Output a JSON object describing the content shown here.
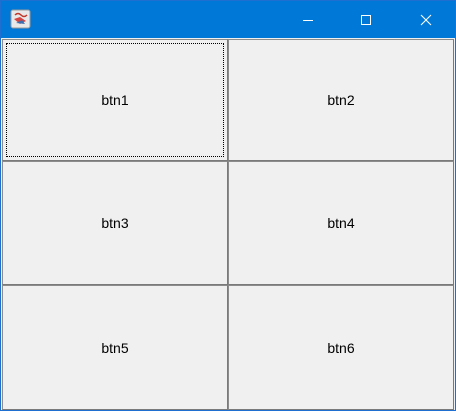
{
  "window": {
    "icons": {
      "app": "java-cup-icon",
      "minimize": "minimize-icon",
      "maximize": "maximize-icon",
      "close": "close-icon"
    },
    "colors": {
      "titlebar": "#0078d7",
      "background": "#f0f0f0"
    }
  },
  "buttons": [
    {
      "label": "btn1",
      "focused": true
    },
    {
      "label": "btn2",
      "focused": false
    },
    {
      "label": "btn3",
      "focused": false
    },
    {
      "label": "btn4",
      "focused": false
    },
    {
      "label": "btn5",
      "focused": false
    },
    {
      "label": "btn6",
      "focused": false
    }
  ]
}
